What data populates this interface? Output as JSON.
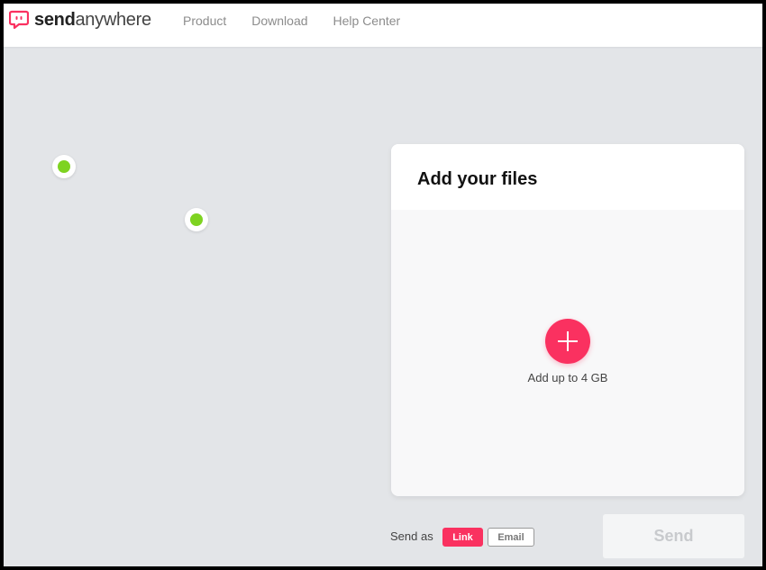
{
  "header": {
    "logo": {
      "bold": "send",
      "light": "anywhere",
      "icon": "send-anywhere-logo-icon",
      "color": "#fa3160"
    },
    "nav": [
      {
        "label": "Product"
      },
      {
        "label": "Download"
      },
      {
        "label": "Help Center"
      }
    ]
  },
  "map": {
    "device_dot_color": "#7ed321",
    "background": "#e3e5e8"
  },
  "upload_card": {
    "title": "Add your files",
    "add_icon": "plus-icon",
    "caption": "Add up to 4 GB"
  },
  "send_options": {
    "label": "Send as",
    "options": [
      {
        "label": "Link",
        "selected": true
      },
      {
        "label": "Email",
        "selected": false
      }
    ],
    "send_label": "Send",
    "accent": "#fa3160"
  }
}
